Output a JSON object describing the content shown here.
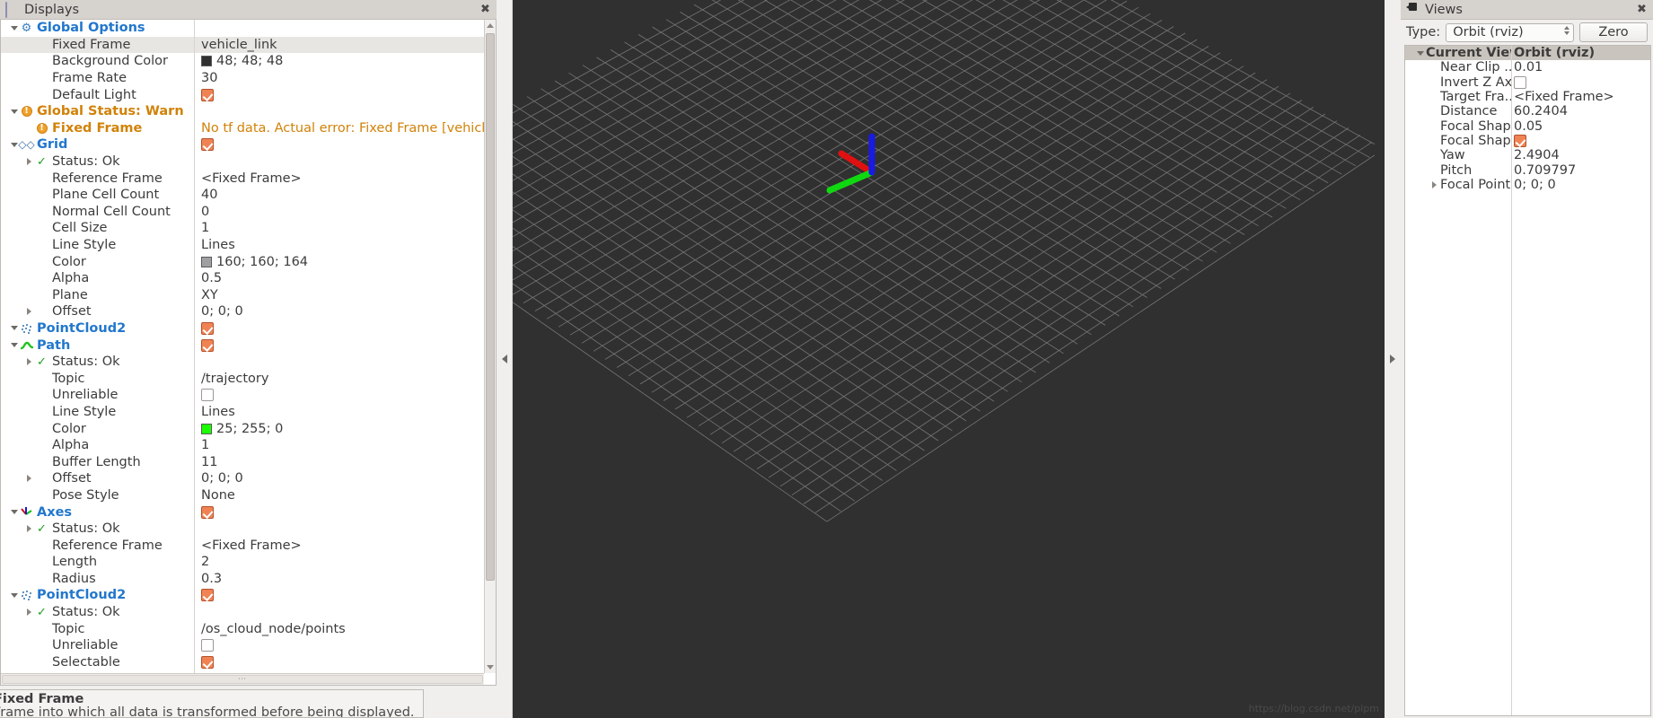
{
  "displays_panel": {
    "title": "Displays",
    "title_icon": "monitor-icon",
    "close_label": "✖",
    "rows": [
      {
        "indent": 0,
        "exp": "open",
        "icon": "gear-icon",
        "name": "Global Options",
        "cls": "hdr",
        "vtype": "none",
        "value": ""
      },
      {
        "indent": 1,
        "exp": "none",
        "icon": "",
        "name": "Fixed Frame",
        "cls": "",
        "vtype": "text",
        "value": "vehicle_link",
        "selected": true
      },
      {
        "indent": 1,
        "exp": "none",
        "icon": "",
        "name": "Background Color",
        "cls": "",
        "vtype": "color",
        "value": "48; 48; 48",
        "swatch": "#303030"
      },
      {
        "indent": 1,
        "exp": "none",
        "icon": "",
        "name": "Frame Rate",
        "cls": "",
        "vtype": "text",
        "value": "30"
      },
      {
        "indent": 1,
        "exp": "none",
        "icon": "",
        "name": "Default Light",
        "cls": "",
        "vtype": "check",
        "value": "checked"
      },
      {
        "indent": 0,
        "exp": "open",
        "icon": "warn-icon",
        "name": "Global Status: Warn",
        "cls": "warn",
        "vtype": "none",
        "value": ""
      },
      {
        "indent": 1,
        "exp": "none",
        "icon": "warn-icon",
        "name": "Fixed Frame",
        "cls": "warn",
        "vtype": "warntext",
        "value": "No tf data.  Actual error: Fixed Frame [vehicle_..."
      },
      {
        "indent": 0,
        "exp": "open",
        "icon": "grid-icon",
        "name": "Grid",
        "cls": "hdr",
        "vtype": "check",
        "value": "checked"
      },
      {
        "indent": 1,
        "exp": "closed",
        "icon": "check-icon",
        "name": "Status: Ok",
        "cls": "",
        "vtype": "none",
        "value": ""
      },
      {
        "indent": 1,
        "exp": "none",
        "icon": "",
        "name": "Reference Frame",
        "cls": "",
        "vtype": "text",
        "value": "<Fixed Frame>"
      },
      {
        "indent": 1,
        "exp": "none",
        "icon": "",
        "name": "Plane Cell Count",
        "cls": "",
        "vtype": "text",
        "value": "40"
      },
      {
        "indent": 1,
        "exp": "none",
        "icon": "",
        "name": "Normal Cell Count",
        "cls": "",
        "vtype": "text",
        "value": "0"
      },
      {
        "indent": 1,
        "exp": "none",
        "icon": "",
        "name": "Cell Size",
        "cls": "",
        "vtype": "text",
        "value": "1"
      },
      {
        "indent": 1,
        "exp": "none",
        "icon": "",
        "name": "Line Style",
        "cls": "",
        "vtype": "text",
        "value": "Lines"
      },
      {
        "indent": 1,
        "exp": "none",
        "icon": "",
        "name": "Color",
        "cls": "",
        "vtype": "color",
        "value": "160; 160; 164",
        "swatch": "#a0a0a4"
      },
      {
        "indent": 1,
        "exp": "none",
        "icon": "",
        "name": "Alpha",
        "cls": "",
        "vtype": "text",
        "value": "0.5"
      },
      {
        "indent": 1,
        "exp": "none",
        "icon": "",
        "name": "Plane",
        "cls": "",
        "vtype": "text",
        "value": "XY"
      },
      {
        "indent": 1,
        "exp": "closed",
        "icon": "",
        "name": "Offset",
        "cls": "",
        "vtype": "text",
        "value": "0; 0; 0"
      },
      {
        "indent": 0,
        "exp": "open",
        "icon": "pointcloud-icon",
        "name": "PointCloud2",
        "cls": "hdr",
        "vtype": "check",
        "value": "checked"
      },
      {
        "indent": 0,
        "exp": "open",
        "icon": "path-icon",
        "name": "Path",
        "cls": "hdr",
        "vtype": "check",
        "value": "checked"
      },
      {
        "indent": 1,
        "exp": "closed",
        "icon": "check-icon",
        "name": "Status: Ok",
        "cls": "",
        "vtype": "none",
        "value": ""
      },
      {
        "indent": 1,
        "exp": "none",
        "icon": "",
        "name": "Topic",
        "cls": "",
        "vtype": "text",
        "value": "/trajectory"
      },
      {
        "indent": 1,
        "exp": "none",
        "icon": "",
        "name": "Unreliable",
        "cls": "",
        "vtype": "uncheck",
        "value": "unchecked"
      },
      {
        "indent": 1,
        "exp": "none",
        "icon": "",
        "name": "Line Style",
        "cls": "",
        "vtype": "text",
        "value": "Lines"
      },
      {
        "indent": 1,
        "exp": "none",
        "icon": "",
        "name": "Color",
        "cls": "",
        "vtype": "color",
        "value": "25; 255; 0",
        "swatch": "#19ff00"
      },
      {
        "indent": 1,
        "exp": "none",
        "icon": "",
        "name": "Alpha",
        "cls": "",
        "vtype": "text",
        "value": "1"
      },
      {
        "indent": 1,
        "exp": "none",
        "icon": "",
        "name": "Buffer Length",
        "cls": "",
        "vtype": "text",
        "value": "11"
      },
      {
        "indent": 1,
        "exp": "closed",
        "icon": "",
        "name": "Offset",
        "cls": "",
        "vtype": "text",
        "value": "0; 0; 0"
      },
      {
        "indent": 1,
        "exp": "none",
        "icon": "",
        "name": "Pose Style",
        "cls": "",
        "vtype": "text",
        "value": "None"
      },
      {
        "indent": 0,
        "exp": "open",
        "icon": "axes-icon",
        "name": "Axes",
        "cls": "hdr",
        "vtype": "check",
        "value": "checked"
      },
      {
        "indent": 1,
        "exp": "closed",
        "icon": "check-icon",
        "name": "Status: Ok",
        "cls": "",
        "vtype": "none",
        "value": ""
      },
      {
        "indent": 1,
        "exp": "none",
        "icon": "",
        "name": "Reference Frame",
        "cls": "",
        "vtype": "text",
        "value": "<Fixed Frame>"
      },
      {
        "indent": 1,
        "exp": "none",
        "icon": "",
        "name": "Length",
        "cls": "",
        "vtype": "text",
        "value": "2"
      },
      {
        "indent": 1,
        "exp": "none",
        "icon": "",
        "name": "Radius",
        "cls": "",
        "vtype": "text",
        "value": "0.3"
      },
      {
        "indent": 0,
        "exp": "open",
        "icon": "pointcloud-icon",
        "name": "PointCloud2",
        "cls": "hdr",
        "vtype": "check",
        "value": "checked"
      },
      {
        "indent": 1,
        "exp": "closed",
        "icon": "check-icon",
        "name": "Status: Ok",
        "cls": "",
        "vtype": "none",
        "value": ""
      },
      {
        "indent": 1,
        "exp": "none",
        "icon": "",
        "name": "Topic",
        "cls": "",
        "vtype": "text",
        "value": "/os_cloud_node/points"
      },
      {
        "indent": 1,
        "exp": "none",
        "icon": "",
        "name": "Unreliable",
        "cls": "",
        "vtype": "uncheck",
        "value": "unchecked"
      },
      {
        "indent": 1,
        "exp": "none",
        "icon": "",
        "name": "Selectable",
        "cls": "",
        "vtype": "check",
        "value": "checked"
      }
    ],
    "help": {
      "title": "Fixed Frame",
      "body": "Frame into which all data is transformed before being displayed."
    }
  },
  "views_panel": {
    "title": "Views",
    "title_icon": "camera-icon",
    "close_label": "✖",
    "type_label": "Type:",
    "type_value": "Orbit (rviz)",
    "zero_button": "Zero",
    "header": {
      "name": "Current View",
      "value": "Orbit (rviz)"
    },
    "rows": [
      {
        "name": "Near Clip ...",
        "vtype": "text",
        "value": "0.01",
        "exp": "none"
      },
      {
        "name": "Invert Z Axis",
        "vtype": "uncheck",
        "value": "unchecked",
        "exp": "none"
      },
      {
        "name": "Target Fra...",
        "vtype": "text",
        "value": "<Fixed Frame>",
        "exp": "none"
      },
      {
        "name": "Distance",
        "vtype": "text",
        "value": "60.2404",
        "exp": "none"
      },
      {
        "name": "Focal Shap...",
        "vtype": "text",
        "value": "0.05",
        "exp": "none"
      },
      {
        "name": "Focal Shap...",
        "vtype": "check",
        "value": "checked",
        "exp": "none"
      },
      {
        "name": "Yaw",
        "vtype": "text",
        "value": "2.4904",
        "exp": "none"
      },
      {
        "name": "Pitch",
        "vtype": "text",
        "value": "0.709797",
        "exp": "none"
      },
      {
        "name": "Focal Point",
        "vtype": "text",
        "value": "0; 0; 0",
        "exp": "closed"
      }
    ]
  },
  "viewport": {
    "background_color": "#303030",
    "grid_color": "#a0a0a4",
    "grid_cells": 40,
    "axes": {
      "x_color": "#e01010",
      "y_color": "#10d810",
      "z_color": "#1a1ae0"
    },
    "watermark": "https://blog.csdn.net/plpm"
  },
  "splitters": {
    "left_collapse": "◀",
    "right_collapse": "▶"
  }
}
